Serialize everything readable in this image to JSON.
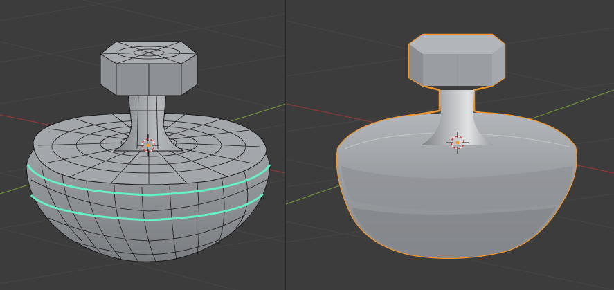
{
  "viewports": [
    {
      "mode": "edit",
      "object": "mesh",
      "selection": "edge-loops"
    },
    {
      "mode": "object",
      "object": "mesh",
      "selection": "object-outline"
    }
  ],
  "colors": {
    "background": "#3c3c3c",
    "grid": "#454545",
    "x_axis": "#8a3a3a",
    "y_axis": "#6f8a3c",
    "mesh": "#9c9fa3",
    "wire": "#1a1a1a",
    "edge_select": "#67f0c4",
    "outline": "#f0962a"
  }
}
